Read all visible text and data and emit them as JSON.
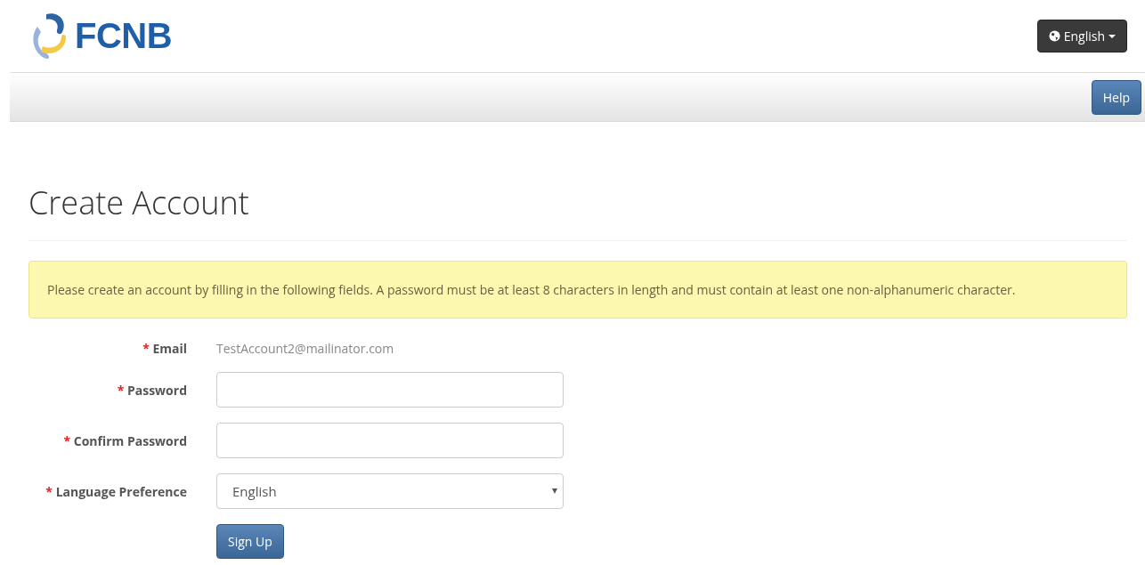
{
  "header": {
    "logo_text": "FCNB",
    "language_button": "English"
  },
  "navbar": {
    "help_button": "Help"
  },
  "page_title": "Create Account",
  "alert": "Please create an account by filling in the following fields. A password must be at least 8 characters in length and must contain at least one non-alphanumeric character.",
  "form": {
    "fields": [
      {
        "kind": "static",
        "marker": "*",
        "label": "Email",
        "value": "TestAccount2@mailinator.com"
      },
      {
        "kind": "input",
        "marker": "*",
        "label": "Password"
      },
      {
        "kind": "input",
        "marker": "*",
        "label": "Confirm Password"
      },
      {
        "kind": "select",
        "marker": "*",
        "label": "Language Preference",
        "value": "English"
      }
    ],
    "submit": "Sign Up"
  }
}
